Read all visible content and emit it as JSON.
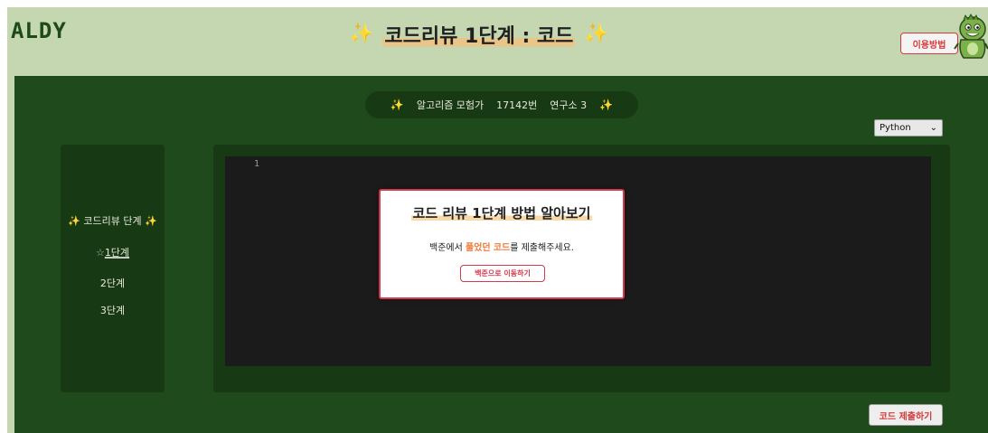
{
  "header": {
    "logo": "ALDY",
    "sparkle": "✨",
    "title": "코드리뷰 1단계 : 코드",
    "help_label": "이용방법"
  },
  "problem": {
    "sparkle": "✨",
    "tier": "알고리즘 모험가",
    "number": "17142번",
    "name": "연구소 3"
  },
  "language": {
    "selected": "Python",
    "arrow": "⌄"
  },
  "sidebar": {
    "heading": "코드리뷰 단계",
    "sparkle": "✨",
    "active_marker": "☆",
    "steps": [
      {
        "label": "1단계",
        "active": true
      },
      {
        "label": "2단계",
        "active": false
      },
      {
        "label": "3단계",
        "active": false
      }
    ]
  },
  "editor": {
    "line_number": "1"
  },
  "submit_label": "코드 제출하기",
  "modal": {
    "title": "코드 리뷰 1단계 방법 알아보기",
    "desc_prefix": "백준에서",
    "desc_hl1": "풀었던",
    "desc_hl2": "코드",
    "desc_suffix": "를 제출해주세요.",
    "button": "백준으로 이동하기"
  },
  "colors": {
    "background": "#c4d7b0",
    "main_green": "#1f4a1c",
    "panel_green": "#173a15",
    "accent_red": "#d6394c",
    "highlight_orange": "#f07a3a",
    "sparkle_yellow": "#f2c233"
  }
}
